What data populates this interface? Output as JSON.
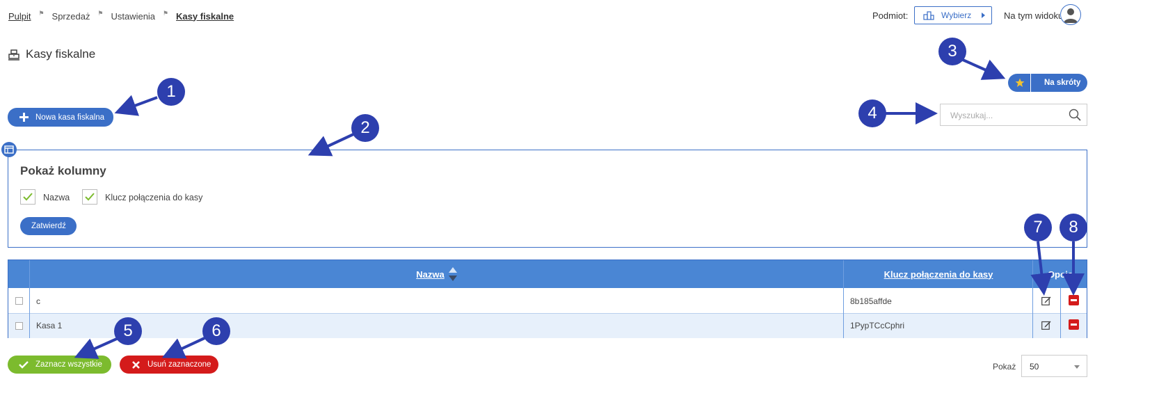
{
  "breadcrumb": {
    "items": [
      {
        "label": "Pulpit"
      },
      {
        "label": "Sprzedaż"
      },
      {
        "label": "Ustawienia"
      },
      {
        "label": "Kasy fiskalne"
      }
    ]
  },
  "header": {
    "entity_label": "Podmiot:",
    "select_button_label": "Wybierz",
    "view_label": "Na tym widoku"
  },
  "page": {
    "title": "Kasy fiskalne"
  },
  "toolbar": {
    "new_button_label": "Nowa kasa fiskalna",
    "shortcut_label": "Na skróty",
    "search_placeholder": "Wyszukaj..."
  },
  "columns_panel": {
    "title": "Pokaż kolumny",
    "options": [
      {
        "label": "Nazwa",
        "checked": true
      },
      {
        "label": "Klucz połączenia do kasy",
        "checked": true
      }
    ],
    "confirm_label": "Zatwierdź"
  },
  "table": {
    "headers": {
      "name": "Nazwa",
      "key": "Klucz połączenia do kasy",
      "options": "Opcje"
    },
    "rows": [
      {
        "name": "c",
        "key": "8b185affde"
      },
      {
        "name": "Kasa 1",
        "key": "1PypTCcCphri"
      }
    ]
  },
  "footer": {
    "select_all_label": "Zaznacz wszystkie",
    "delete_selected_label": "Usuń zaznaczone",
    "show_label": "Pokaż",
    "page_size": "50"
  },
  "annotations": {
    "markers": [
      "1",
      "2",
      "3",
      "4",
      "5",
      "6",
      "7",
      "8"
    ],
    "color": "#2d3fae"
  },
  "colors": {
    "primary": "#3b6fc7",
    "header_bg": "#4a86d4",
    "success": "#7cbb2e",
    "danger": "#d41b1b",
    "row_alt": "#e7f0fb"
  }
}
